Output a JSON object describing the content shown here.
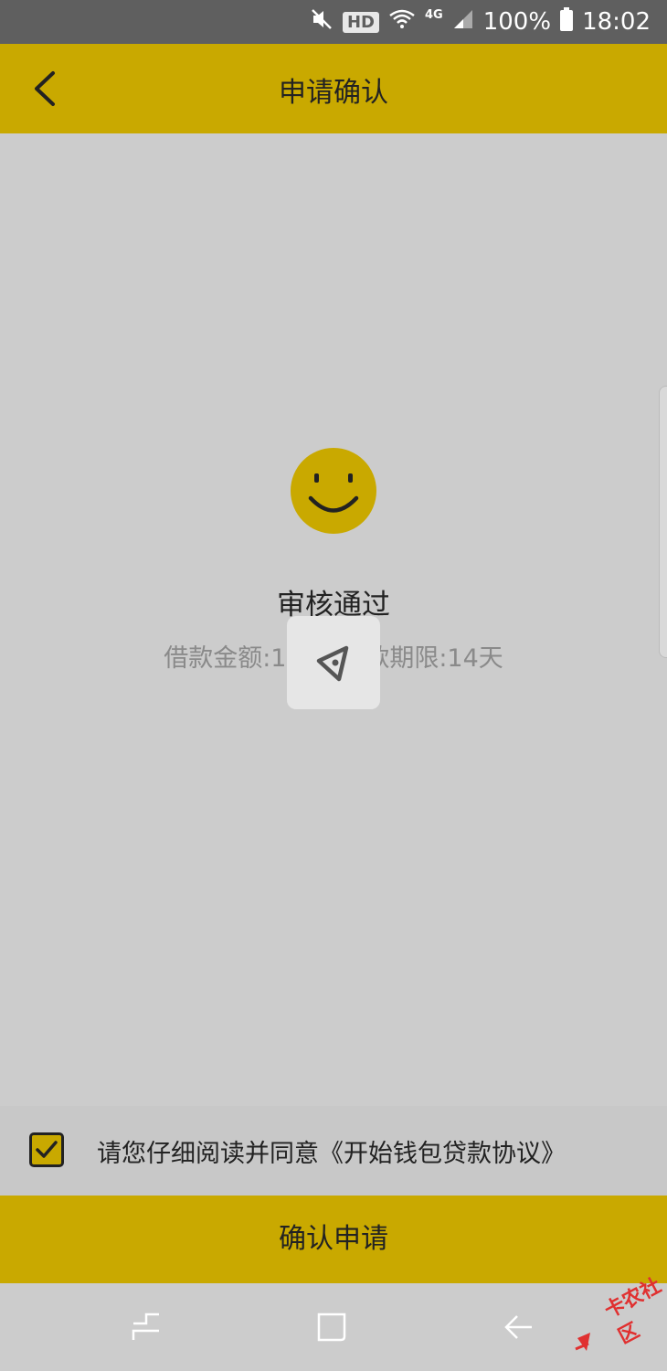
{
  "status_bar": {
    "hd": "HD",
    "network": "4G",
    "battery": "100%",
    "time": "18:02"
  },
  "header": {
    "title": "申请确认"
  },
  "result": {
    "title": "审核通过",
    "loan_info": "借款金额:10        款期限:14天"
  },
  "agreement": {
    "checked": true,
    "text": "请您仔细阅读并同意《开始钱包贷款协议》"
  },
  "confirm_button": {
    "label": "确认申请"
  },
  "watermark": {
    "text": "卡农社区"
  },
  "colors": {
    "brand": "#c9a900",
    "background": "#cccccc",
    "status_bar": "#5f5f5f"
  }
}
